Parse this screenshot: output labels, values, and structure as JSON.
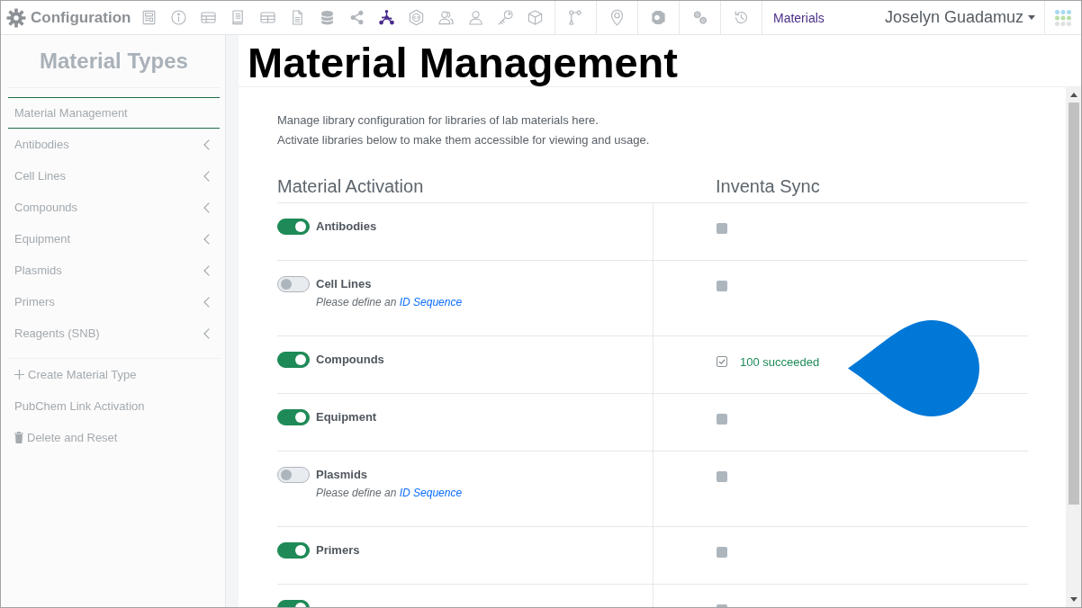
{
  "top_bar": {
    "title": "Configuration",
    "app_icons": [
      {
        "selected": false
      },
      {
        "selected": false
      },
      {
        "selected": false
      },
      {
        "selected": false
      },
      {
        "selected": false
      },
      {
        "selected": false
      },
      {
        "selected": false
      },
      {
        "selected": false
      },
      {
        "selected": true
      },
      {
        "selected": false
      },
      {
        "selected": false
      },
      {
        "selected": false
      },
      {
        "selected": false
      },
      {
        "selected": false
      }
    ],
    "tool_icons": [
      {
        "selected": false
      },
      {
        "selected": false
      },
      {
        "selected": false
      },
      {
        "selected": false
      },
      {
        "selected": false
      }
    ],
    "module": "Materials",
    "user": "Joselyn Guadamuz"
  },
  "sidebar": {
    "title": "Material Types",
    "items": [
      {
        "label": "Material Management",
        "kind": "page",
        "selected": true
      },
      {
        "label": "Antibodies",
        "kind": "group",
        "selected": false
      },
      {
        "label": "Cell Lines",
        "kind": "group",
        "selected": false
      },
      {
        "label": "Compounds",
        "kind": "group",
        "selected": false
      },
      {
        "label": "Equipment",
        "kind": "group",
        "selected": false
      },
      {
        "label": "Plasmids",
        "kind": "group",
        "selected": false
      },
      {
        "label": "Primers",
        "kind": "group",
        "selected": false
      },
      {
        "label": "Reagents (SNB)",
        "kind": "group",
        "selected": false
      }
    ],
    "actions": [
      {
        "kind": "create",
        "label": "Create Material Type"
      },
      {
        "kind": "link",
        "label": "PubChem Link Activation"
      },
      {
        "kind": "delete",
        "label": "Delete and Reset"
      }
    ]
  },
  "main": {
    "title": "Material Management",
    "description": [
      "Manage library configuration for libraries of lab materials here.",
      "Activate libraries below to make them accessible for viewing and usage."
    ],
    "columns": [
      "Material Activation",
      "Inventa Sync"
    ],
    "materials": [
      {
        "name": "Antibodies",
        "active": true,
        "sync_checked": false
      },
      {
        "name": "Cell Lines",
        "active": false,
        "note": {
          "text": "Please define an",
          "link": "ID Sequence"
        },
        "sync_checked": false
      },
      {
        "name": "Compounds",
        "active": true,
        "sync_checked": true,
        "sync_status": "100 succeeded"
      },
      {
        "name": "Equipment",
        "active": true,
        "sync_checked": false
      },
      {
        "name": "Plasmids",
        "active": false,
        "note": {
          "text": "Please define an",
          "link": "ID Sequence"
        },
        "sync_checked": false
      },
      {
        "name": "Primers",
        "active": true,
        "sync_checked": false
      },
      {
        "active": true,
        "sync_checked": false
      }
    ]
  }
}
